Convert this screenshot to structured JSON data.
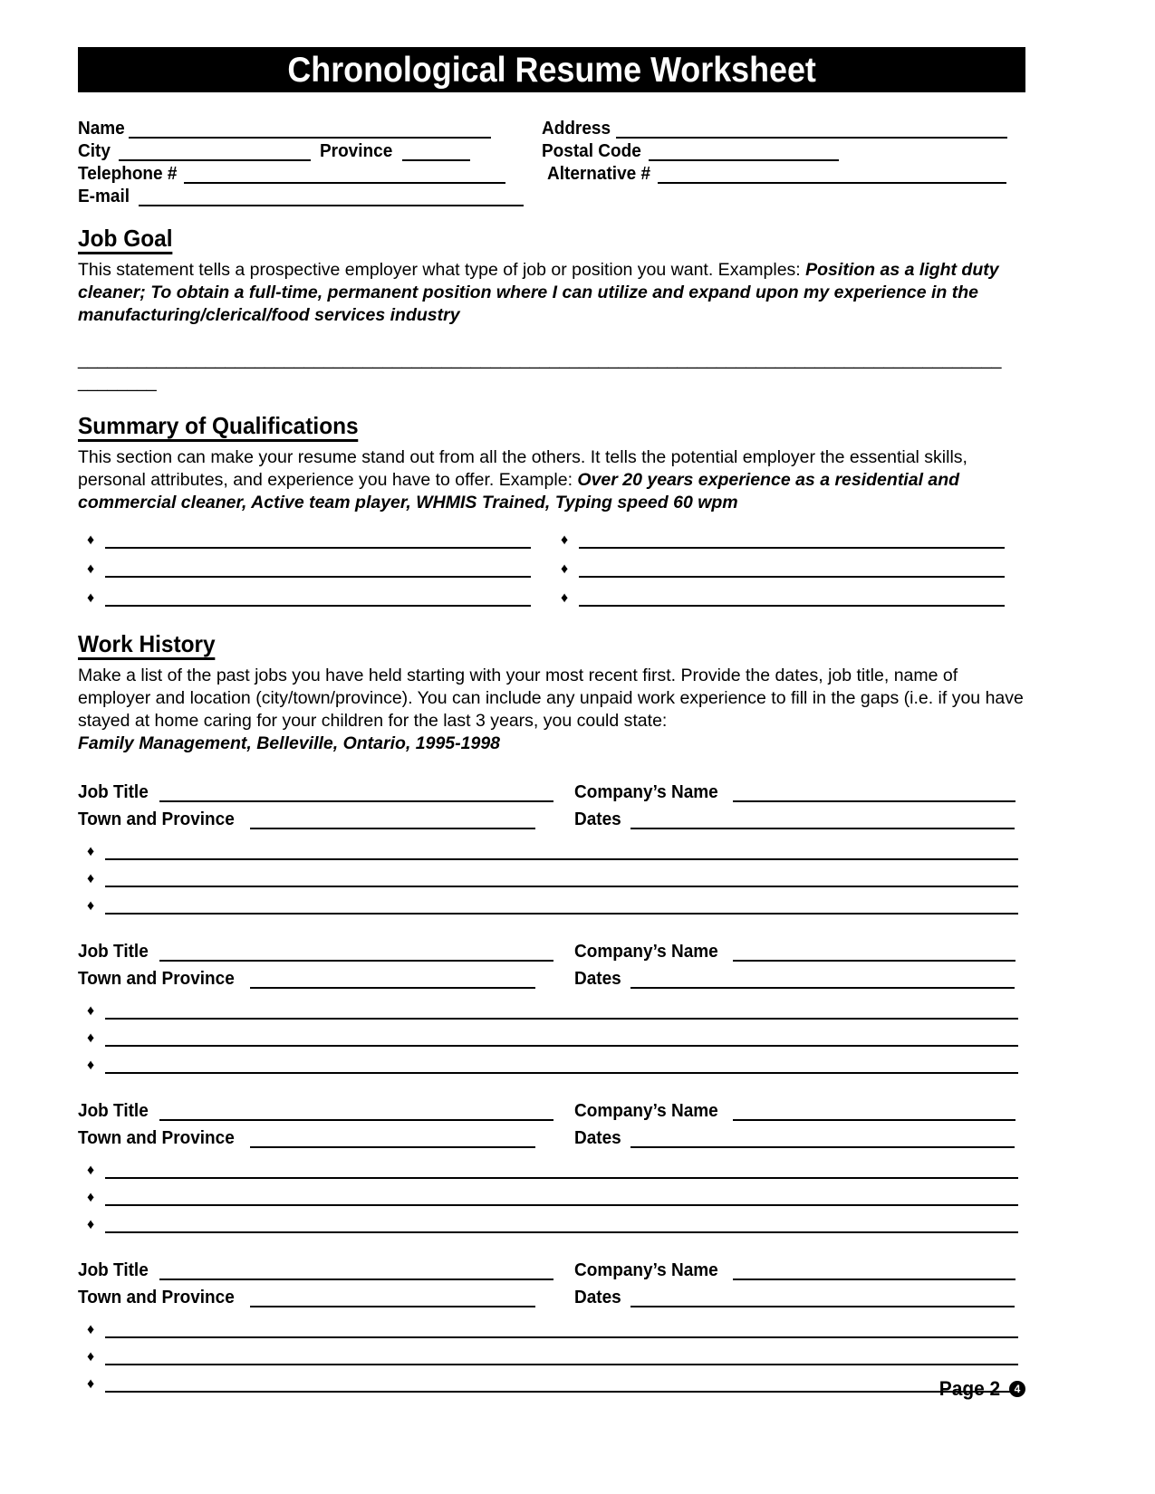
{
  "document": {
    "title": "Chronological Resume Worksheet"
  },
  "contact": {
    "name_label": "Name",
    "address_label": "Address",
    "city_label": "City",
    "province_label": "Province",
    "postal_code_label": "Postal Code",
    "telephone_label": "Telephone #",
    "alternative_label": "Alternative #",
    "email_label": "E-mail"
  },
  "job_goal": {
    "heading": "Job Goal",
    "intro": "This statement tells a prospective employer what type of job or position you want. Examples: ",
    "example": "Position as a light duty cleaner; To obtain a full-time, permanent position where I can utilize and expand upon my experience in the manufacturing/clerical/food services industry",
    "fill_line_1": "______________________________________________________________________________________________",
    "fill_line_2": "________"
  },
  "summary": {
    "heading": "Summary of Qualifications",
    "intro": "This section can make your resume stand out from all the others. It tells the potential employer the essential skills, personal attributes, and experience you have to offer. Example:  ",
    "example": "Over 20 years experience as a residential and commercial cleaner, Active team player, WHMIS Trained, Typing speed 60 wpm",
    "bullet_glyph": "♦",
    "rows": 3,
    "columns": 2
  },
  "work_history": {
    "heading": "Work History",
    "intro": "Make a list of the past jobs you have held starting with your most recent first.  Provide the dates, job title, name of employer and location (city/town/province).  You can include any unpaid work experience to fill in the gaps (i.e. if you have stayed at home caring for your children for the last 3 years, you could state:",
    "example": "Family Management, Belleville, Ontario, 1995-1998",
    "bullet_glyph": "♦",
    "entry_labels": {
      "job_title": "Job Title",
      "company_name": "Company’s Name",
      "town_province": "Town and Province",
      "dates": "Dates"
    },
    "entry_count": 4,
    "bullets_per_entry": 3
  },
  "footer": {
    "page_label": "Page 2",
    "badge": "4"
  }
}
